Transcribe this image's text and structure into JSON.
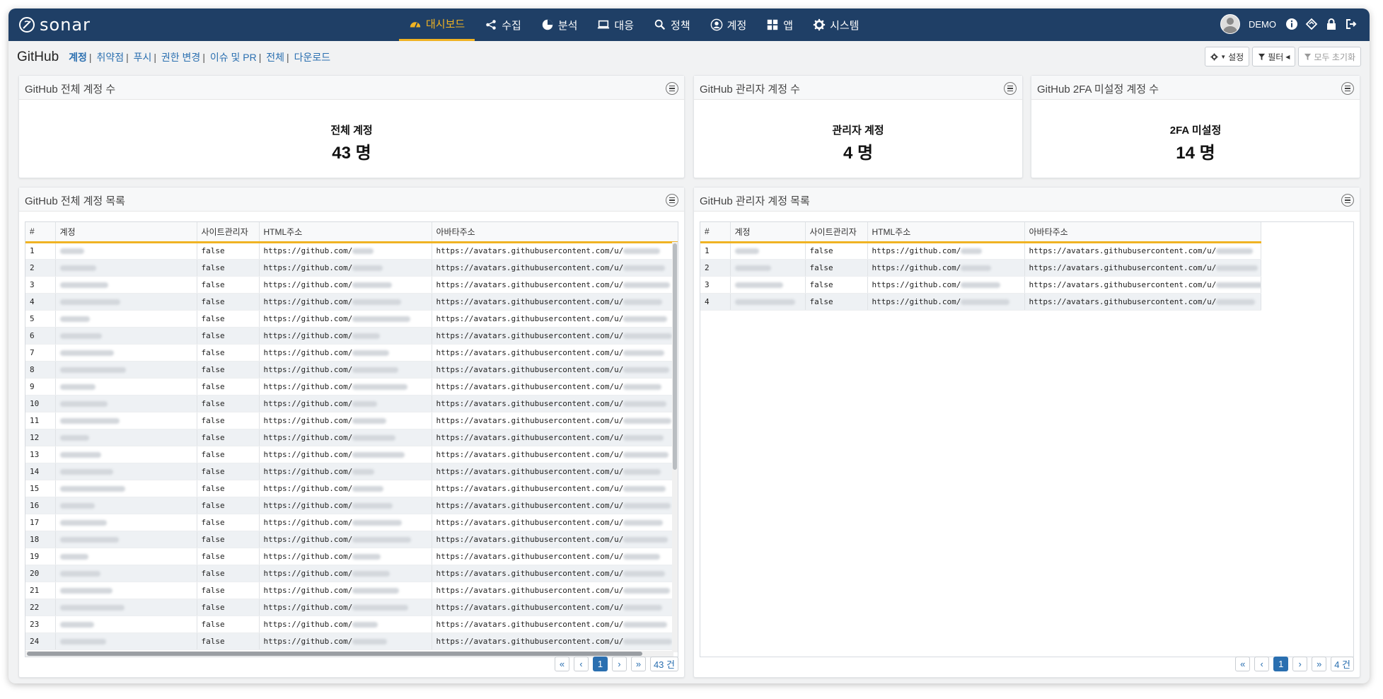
{
  "app": {
    "name": "sonar",
    "user": "DEMO"
  },
  "nav": [
    {
      "label": "대시보드",
      "icon": "dashboard-icon",
      "active": true
    },
    {
      "label": "수집",
      "icon": "share-icon"
    },
    {
      "label": "분석",
      "icon": "pie-chart-icon"
    },
    {
      "label": "대응",
      "icon": "laptop-icon"
    },
    {
      "label": "정책",
      "icon": "search-icon"
    },
    {
      "label": "계정",
      "icon": "user-circle-icon"
    },
    {
      "label": "앱",
      "icon": "apps-grid-icon"
    },
    {
      "label": "시스템",
      "icon": "gear-icon"
    }
  ],
  "page": {
    "title": "GitHub",
    "tabs": [
      "계정",
      "취약점",
      "푸시",
      "권한 변경",
      "이슈 및 PR",
      "전체",
      "다운로드"
    ],
    "buttons": {
      "settings": "설정",
      "filter": "필터",
      "reset": "모두 초기화"
    }
  },
  "cards": {
    "total": {
      "title": "GitHub 전체 계정 수",
      "label": "전체 계정",
      "value": "43 명"
    },
    "admin": {
      "title": "GitHub 관리자 계정 수",
      "label": "관리자 계정",
      "value": "4 명"
    },
    "no2fa": {
      "title": "GitHub 2FA 미설정 계정 수",
      "label": "2FA 미설정",
      "value": "14 명"
    }
  },
  "all_accounts": {
    "title": "GitHub 전체 계정 목록",
    "columns": [
      "#",
      "계정",
      "사이트관리자",
      "HTML주소",
      "아바타주소"
    ],
    "html_prefix": "https://github.com/",
    "avatar_prefix": "https://avatars.githubusercontent.com/u/",
    "rows": [
      {
        "no": "1",
        "site_admin": "false"
      },
      {
        "no": "2",
        "site_admin": "false"
      },
      {
        "no": "3",
        "site_admin": "false"
      },
      {
        "no": "4",
        "site_admin": "false"
      },
      {
        "no": "5",
        "site_admin": "false"
      },
      {
        "no": "6",
        "site_admin": "false"
      },
      {
        "no": "7",
        "site_admin": "false"
      },
      {
        "no": "8",
        "site_admin": "false"
      },
      {
        "no": "9",
        "site_admin": "false"
      },
      {
        "no": "10",
        "site_admin": "false"
      },
      {
        "no": "11",
        "site_admin": "false"
      },
      {
        "no": "12",
        "site_admin": "false"
      },
      {
        "no": "13",
        "site_admin": "false"
      },
      {
        "no": "14",
        "site_admin": "false"
      },
      {
        "no": "15",
        "site_admin": "false"
      },
      {
        "no": "16",
        "site_admin": "false"
      },
      {
        "no": "17",
        "site_admin": "false"
      },
      {
        "no": "18",
        "site_admin": "false"
      },
      {
        "no": "19",
        "site_admin": "false"
      },
      {
        "no": "20",
        "site_admin": "false"
      },
      {
        "no": "21",
        "site_admin": "false"
      },
      {
        "no": "22",
        "site_admin": "false"
      },
      {
        "no": "23",
        "site_admin": "false"
      },
      {
        "no": "24",
        "site_admin": "false"
      }
    ],
    "pager": {
      "first": "«",
      "prev": "‹",
      "current": "1",
      "next": "›",
      "last": "»",
      "count": "43 건"
    }
  },
  "admin_accounts": {
    "title": "GitHub 관리자 계정 목록",
    "columns": [
      "#",
      "계정",
      "사이트관리자",
      "HTML주소",
      "아바타주소"
    ],
    "html_prefix": "https://github.com/",
    "avatar_prefix": "https://avatars.githubusercontent.com/u/",
    "rows": [
      {
        "no": "1",
        "site_admin": "false"
      },
      {
        "no": "2",
        "site_admin": "false"
      },
      {
        "no": "3",
        "site_admin": "false"
      },
      {
        "no": "4",
        "site_admin": "false"
      }
    ],
    "pager": {
      "first": "«",
      "prev": "‹",
      "current": "1",
      "next": "›",
      "last": "»",
      "count": "4 건"
    }
  },
  "colors": {
    "nav_bg": "#1f3f66",
    "accent": "#f0b323",
    "link": "#2a6fb0"
  }
}
